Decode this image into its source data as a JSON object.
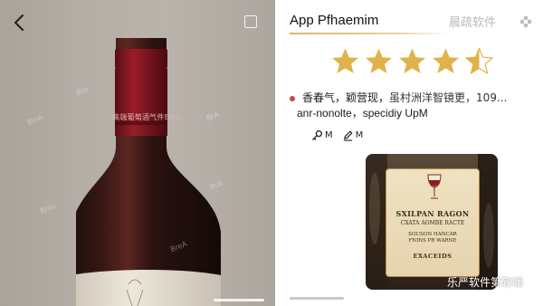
{
  "left": {
    "neck_label": "高端葡萄酒气件BRA",
    "watermarks": [
      "Bro",
      "BrrA",
      "BrA",
      "Bros",
      "BrA",
      "BreA"
    ]
  },
  "right": {
    "app_title": "App Pfhaemim",
    "brand_watermark": "晨疏软件",
    "rating": {
      "value": 4.5,
      "max": 5,
      "color": "#e0b24a",
      "empty_color": "#dcdcdc"
    },
    "info": {
      "part1": "香春气，",
      "part2": "颖营现，",
      "part3": "虽村洲洋智镜更，",
      "number": "109...",
      "subtitle": "anr-nonolte，specidiy UpM"
    },
    "tools": [
      {
        "icon": "key-icon",
        "label": "M"
      },
      {
        "icon": "edit-icon",
        "label": "M"
      }
    ],
    "thumbnail": {
      "line1": "SXILPAN RAGON",
      "line2": "CXATA AOMBE RACTE",
      "line3": "SOUSON HANCAR",
      "line4": "FNINS PR WARNE",
      "line5": "EXACEIDS"
    },
    "bottom_watermark": "乐严软件第软噢"
  }
}
